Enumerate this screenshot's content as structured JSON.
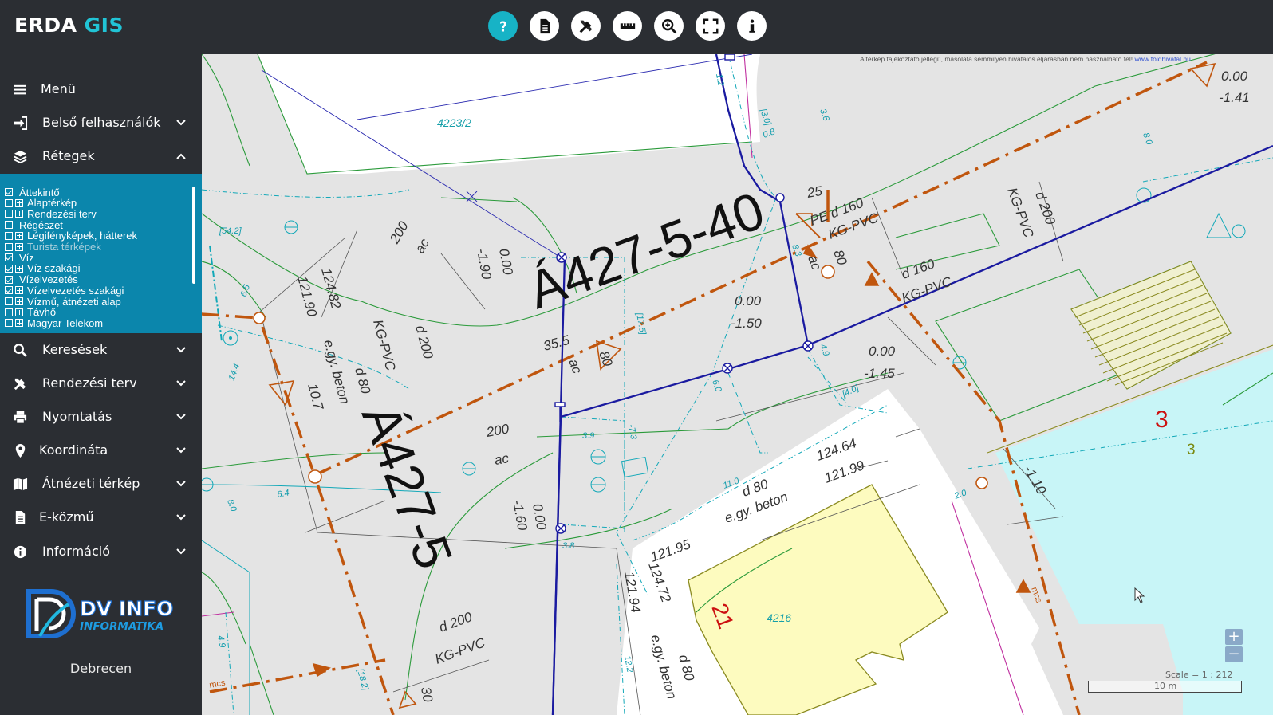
{
  "app": {
    "brand_main": "ERDA",
    "brand_accent": "GIS",
    "accent_color": "#21c4d6"
  },
  "toolbar": [
    {
      "name": "help",
      "icon": "question-icon"
    },
    {
      "name": "document",
      "icon": "document-icon"
    },
    {
      "name": "tools",
      "icon": "tools-icon"
    },
    {
      "name": "measure",
      "icon": "ruler-icon"
    },
    {
      "name": "zoom",
      "icon": "zoom-in-icon"
    },
    {
      "name": "fullscreen",
      "icon": "fullscreen-icon"
    },
    {
      "name": "info",
      "icon": "info-icon"
    }
  ],
  "sidebar": {
    "menu": "Menü",
    "items": [
      {
        "label": "Belső felhasználók",
        "icon": "sign-in-icon"
      },
      {
        "label": "Rétegek",
        "icon": "layers-icon"
      },
      {
        "label": "Keresések",
        "icon": "search-icon"
      },
      {
        "label": "Rendezési terv",
        "icon": "tools-icon"
      },
      {
        "label": "Nyomtatás",
        "icon": "print-icon"
      },
      {
        "label": "Koordináta",
        "icon": "map-marker-icon"
      },
      {
        "label": "Átnézeti térkép",
        "icon": "map-icon"
      },
      {
        "label": "E-közmű",
        "icon": "file-icon"
      },
      {
        "label": "Információ",
        "icon": "info-circle-icon"
      }
    ],
    "city": "Debrecen"
  },
  "layers": [
    {
      "label": "Áttekintő",
      "checked": true,
      "expand": false,
      "indent": 0
    },
    {
      "label": "Alaptérkép",
      "checked": false,
      "expand": true,
      "indent": 1
    },
    {
      "label": "Rendezési terv",
      "checked": false,
      "expand": true,
      "indent": 1
    },
    {
      "label": "Régészet",
      "checked": false,
      "expand": false,
      "indent": 0
    },
    {
      "label": "Légifényképek, hátterek",
      "checked": false,
      "expand": true,
      "indent": 1
    },
    {
      "label": "Turista térképek",
      "checked": false,
      "expand": true,
      "indent": 1,
      "disabled": true
    },
    {
      "label": "Víz",
      "checked": true,
      "expand": false,
      "indent": 0
    },
    {
      "label": "Víz szakági",
      "checked": true,
      "expand": true,
      "indent": 1
    },
    {
      "label": "Vízelvezetés",
      "checked": true,
      "expand": false,
      "indent": 0
    },
    {
      "label": "Vízelvezetés szakági",
      "checked": true,
      "expand": true,
      "indent": 1
    },
    {
      "label": "Vízmű, átnézeti alap",
      "checked": false,
      "expand": true,
      "indent": 1
    },
    {
      "label": "Távhő",
      "checked": false,
      "expand": true,
      "indent": 1
    },
    {
      "label": "Magyar Telekom",
      "checked": false,
      "expand": true,
      "indent": 1
    }
  ],
  "logo": {
    "line1": "DV INFO",
    "line2": "INFORMATIKA"
  },
  "map": {
    "disclaimer": "A térkép tájékoztató jellegű, másolata semmilyen hivatalos eljárásban nem használható fel!",
    "disclaimer_link": "www.foldhivatal.hu",
    "labels": {
      "big1": "Á427-5-40",
      "big2": "Á427-5",
      "parcel1": "4223/2",
      "parcel2": "4216",
      "parcel3_red": "3",
      "parcel3_green": "3",
      "red21": "21",
      "pe_d160": "PE d 160",
      "n25": "25",
      "kgpvc1": "KG-PVC",
      "n80a": "80",
      "ac1": "ac",
      "d160": "d 160",
      "kgpvc2": "KG-PVC",
      "kgpvc3": "KG-PVC",
      "d200a": "d 200",
      "n000a": "0.00",
      "n141": "-1.41",
      "n200a": "200",
      "ac2": "ac",
      "n190": "-1.90",
      "n000b": "0.00",
      "n12482": "124.82",
      "n12190": "121.90",
      "kgpvc4": "KG-PVC",
      "d200b": "d 200",
      "egy1": "e.gy. beton",
      "d80a": "d 80",
      "n107": "10.7",
      "n355": "35.5",
      "ac3": "ac",
      "n80b": "80",
      "n000c": "0.00",
      "n150": "-1.50",
      "n000d": "0.00",
      "n145": "-1.45",
      "n200b": "200",
      "ac4": "ac",
      "n160": "-1.60",
      "n000e": "0.00",
      "n12464": "124.64",
      "n12199": "121.99",
      "d80b": "d 80",
      "egy2": "e.gy. beton",
      "n12195": "121.95",
      "n12472": "124.72",
      "n12194": "121.94",
      "egy3": "e.gy. beton",
      "d80c": "d 80",
      "d200c": "d 200",
      "kgpvc5": "KG-PVC",
      "n110": "-1.10",
      "n30": "30",
      "mcs1": "mcs",
      "mcs2": "mcs",
      "c542": "[54.2]",
      "c65": "6.5",
      "c144": "14.4",
      "c64": "6.4",
      "c80": "8.0",
      "c49a": "4.9",
      "c12": "1.2",
      "c30b": "[3.0]",
      "c08": "0.8",
      "c175": "[17.5]",
      "c39": "3.9",
      "c73": "-7.3",
      "c60": "6.0",
      "c40": "[4.0]",
      "c49b": "4.9",
      "c110": "11.0",
      "c38": "3.8",
      "c20": "2.0",
      "c182": "[18.2]",
      "c122": "12.2",
      "c83": "8.3",
      "c36": "3.6",
      "c80c": "8.0"
    }
  },
  "scale": {
    "text": "Scale = 1 : 212",
    "length": "10 m"
  },
  "zoom": {
    "plus": "+",
    "minus": "−"
  }
}
